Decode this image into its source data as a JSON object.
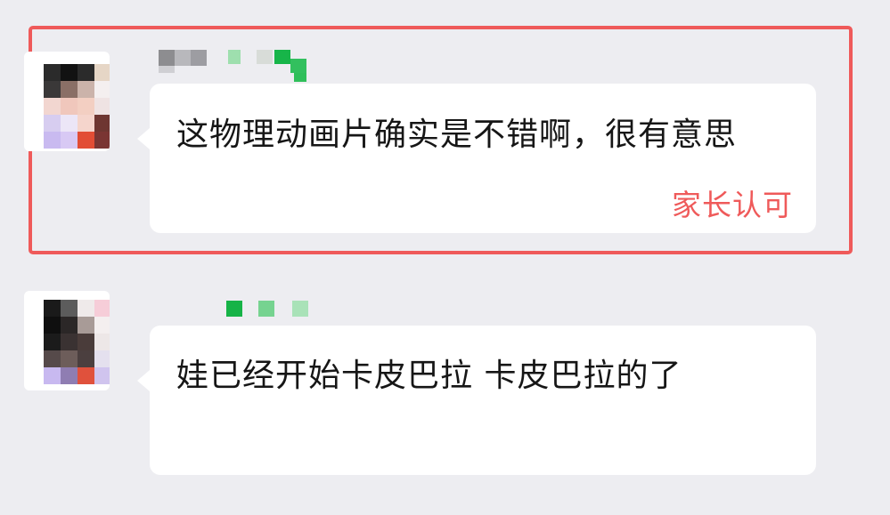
{
  "messages": [
    {
      "text": "这物理动画片确实是不错啊，很有意思",
      "annotation": "家长认可"
    },
    {
      "text": "娃已经开始卡皮巴拉 卡皮巴拉的了"
    }
  ],
  "colors": {
    "background": "#ededf1",
    "bubble": "#ffffff",
    "highlight": "#ef5a5a",
    "text": "#161616"
  }
}
